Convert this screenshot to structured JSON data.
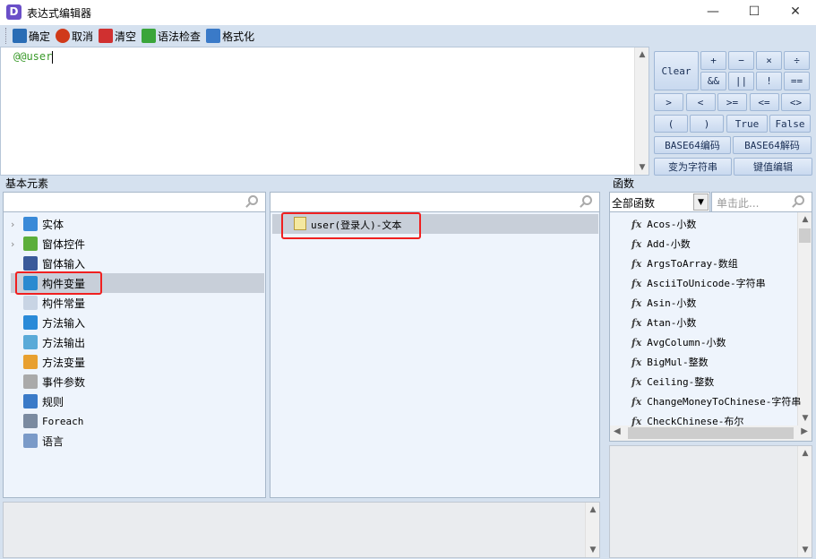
{
  "window": {
    "title": "表达式编辑器",
    "icon_letter": "D",
    "minimize": "—",
    "maximize": "☐",
    "close": "✕"
  },
  "toolbar": [
    {
      "label": "确定",
      "icon": "save-icon",
      "color": "#2a6db5"
    },
    {
      "label": "取消",
      "icon": "power-icon",
      "color": "#d03a1a"
    },
    {
      "label": "清空",
      "icon": "clear-icon",
      "color": "#d03030"
    },
    {
      "label": "语法检查",
      "icon": "shield-check-icon",
      "color": "#3aa53a"
    },
    {
      "label": "格式化",
      "icon": "format-icon",
      "color": "#3a7ac8"
    }
  ],
  "editor": {
    "value": "@@user"
  },
  "operators": {
    "clear": "Clear",
    "row1": [
      "+",
      "−",
      "×",
      "÷"
    ],
    "row2": [
      "&&",
      "||",
      "!",
      "=="
    ],
    "row3": [
      ">",
      "<",
      ">=",
      "<=",
      "<>"
    ],
    "row4": [
      "(",
      ")",
      "True",
      "False"
    ],
    "base64_encode": "BASE64编码",
    "base64_decode": "BASE64解码",
    "to_string": "变为字符串",
    "kv_edit": "键值编辑"
  },
  "basic": {
    "label": "基本元素",
    "items": [
      {
        "label": "实体",
        "expandable": true,
        "icon": "entity-icon",
        "color": "#3a8ad8"
      },
      {
        "label": "窗体控件",
        "expandable": true,
        "icon": "puzzle-icon",
        "color": "#5cae3a"
      },
      {
        "label": "窗体输入",
        "icon": "var-icon",
        "color": "#3a5a9a"
      },
      {
        "label": "构件变量",
        "icon": "variable-icon",
        "color": "#2a8ad0",
        "selected": true
      },
      {
        "label": "构件常量",
        "icon": "constant-icon",
        "color": "#c8d4e4"
      },
      {
        "label": "方法输入",
        "icon": "method-input-icon",
        "color": "#2a8ad8"
      },
      {
        "label": "方法输出",
        "icon": "method-output-icon",
        "color": "#5aaad8"
      },
      {
        "label": "方法变量",
        "icon": "method-variable-icon",
        "color": "#e8a030"
      },
      {
        "label": "事件参数",
        "icon": "keyboard-icon",
        "color": "#aaaaaa"
      },
      {
        "label": "规则",
        "icon": "rule-icon",
        "color": "#3a7ac8"
      },
      {
        "label": "Foreach",
        "icon": "foreach-icon",
        "color": "#7a8aa0"
      },
      {
        "label": "语言",
        "icon": "language-icon",
        "color": "#7a9ac8"
      }
    ]
  },
  "middle": {
    "items": [
      {
        "label": "user(登录人)-文本",
        "selected": true
      }
    ]
  },
  "functions": {
    "label": "函数",
    "category": "全部函数",
    "search_placeholder": "单击此...",
    "items": [
      "Acos-小数",
      "Add-小数",
      "ArgsToArray-数组",
      "AsciiToUnicode-字符串",
      "Asin-小数",
      "Atan-小数",
      "AvgColumn-小数",
      "BigMul-整数",
      "Ceiling-整数",
      "ChangeMoneyToChinese-字符串",
      "CheckChinese-布尔"
    ],
    "fx": "fx"
  }
}
